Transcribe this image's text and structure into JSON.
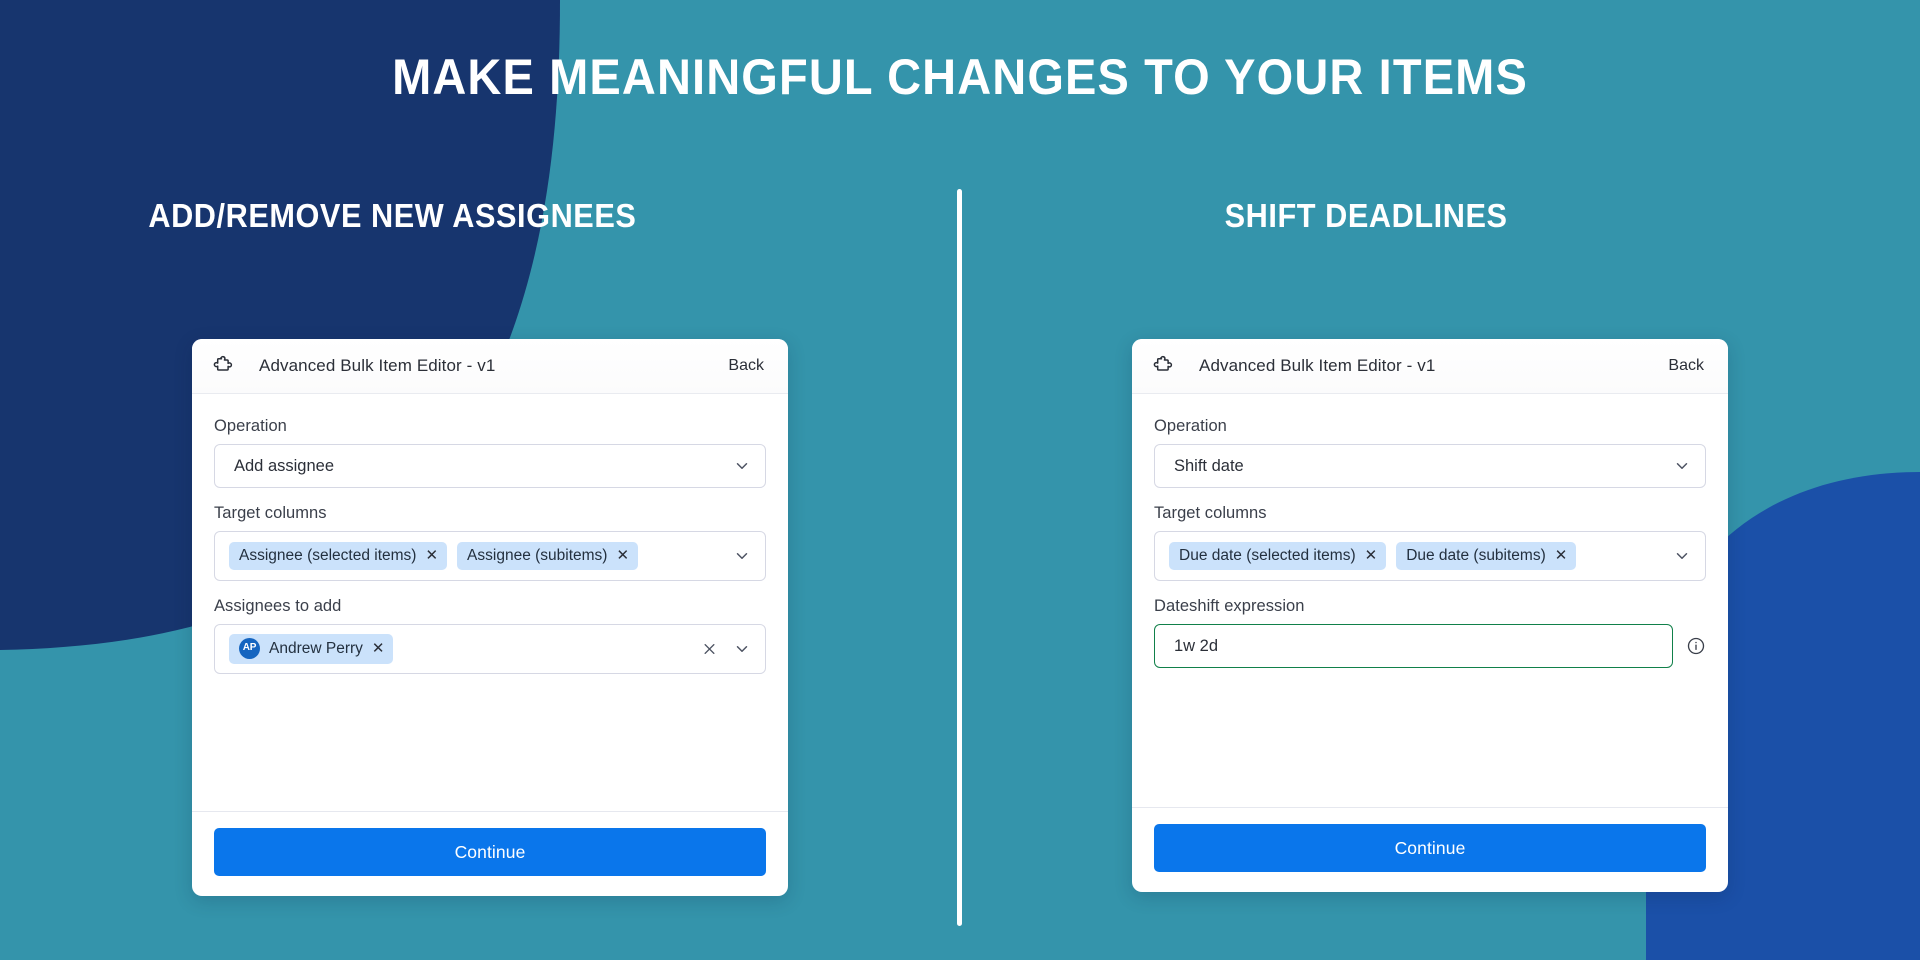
{
  "theme": {
    "background_teal": "#3494ab",
    "navy_blob": "#17356e",
    "blue_blob": "#1b50a8",
    "accent_button": "#0a76eb",
    "chip_blue": "#cbe2fb",
    "valid_green": "#11804a",
    "avatar_blue": "#1565c0"
  },
  "header": {
    "title": "MAKE MEANINGFUL CHANGES TO YOUR ITEMS"
  },
  "sections": {
    "left_subtitle": "ADD/REMOVE NEW ASSIGNEES",
    "right_subtitle": "SHIFT DEADLINES"
  },
  "left_card": {
    "app_title": "Advanced Bulk Item Editor - v1",
    "back_label": "Back",
    "puzzle_icon": "puzzle-piece-icon",
    "operation": {
      "label": "Operation",
      "value": "Add assignee",
      "chevron_icon": "chevron-down-icon"
    },
    "target_columns": {
      "label": "Target columns",
      "chips": [
        {
          "text": "Assignee (selected items)",
          "remove_icon": "close-icon"
        },
        {
          "text": "Assignee (subitems)",
          "remove_icon": "close-icon"
        }
      ],
      "chevron_icon": "chevron-down-icon"
    },
    "assignees": {
      "label": "Assignees to add",
      "chips": [
        {
          "initials": "AP",
          "text": "Andrew Perry",
          "remove_icon": "close-icon"
        }
      ],
      "clear_icon": "close-icon",
      "chevron_icon": "chevron-down-icon"
    },
    "continue_label": "Continue"
  },
  "right_card": {
    "app_title": "Advanced Bulk Item Editor - v1",
    "back_label": "Back",
    "puzzle_icon": "puzzle-piece-icon",
    "operation": {
      "label": "Operation",
      "value": "Shift date",
      "chevron_icon": "chevron-down-icon"
    },
    "target_columns": {
      "label": "Target columns",
      "chips": [
        {
          "text": "Due date (selected items)",
          "remove_icon": "close-icon"
        },
        {
          "text": "Due date (subitems)",
          "remove_icon": "close-icon"
        }
      ],
      "chevron_icon": "chevron-down-icon"
    },
    "dateshift": {
      "label": "Dateshift expression",
      "value": "1w 2d",
      "info_icon": "info-circle-icon"
    },
    "continue_label": "Continue"
  }
}
